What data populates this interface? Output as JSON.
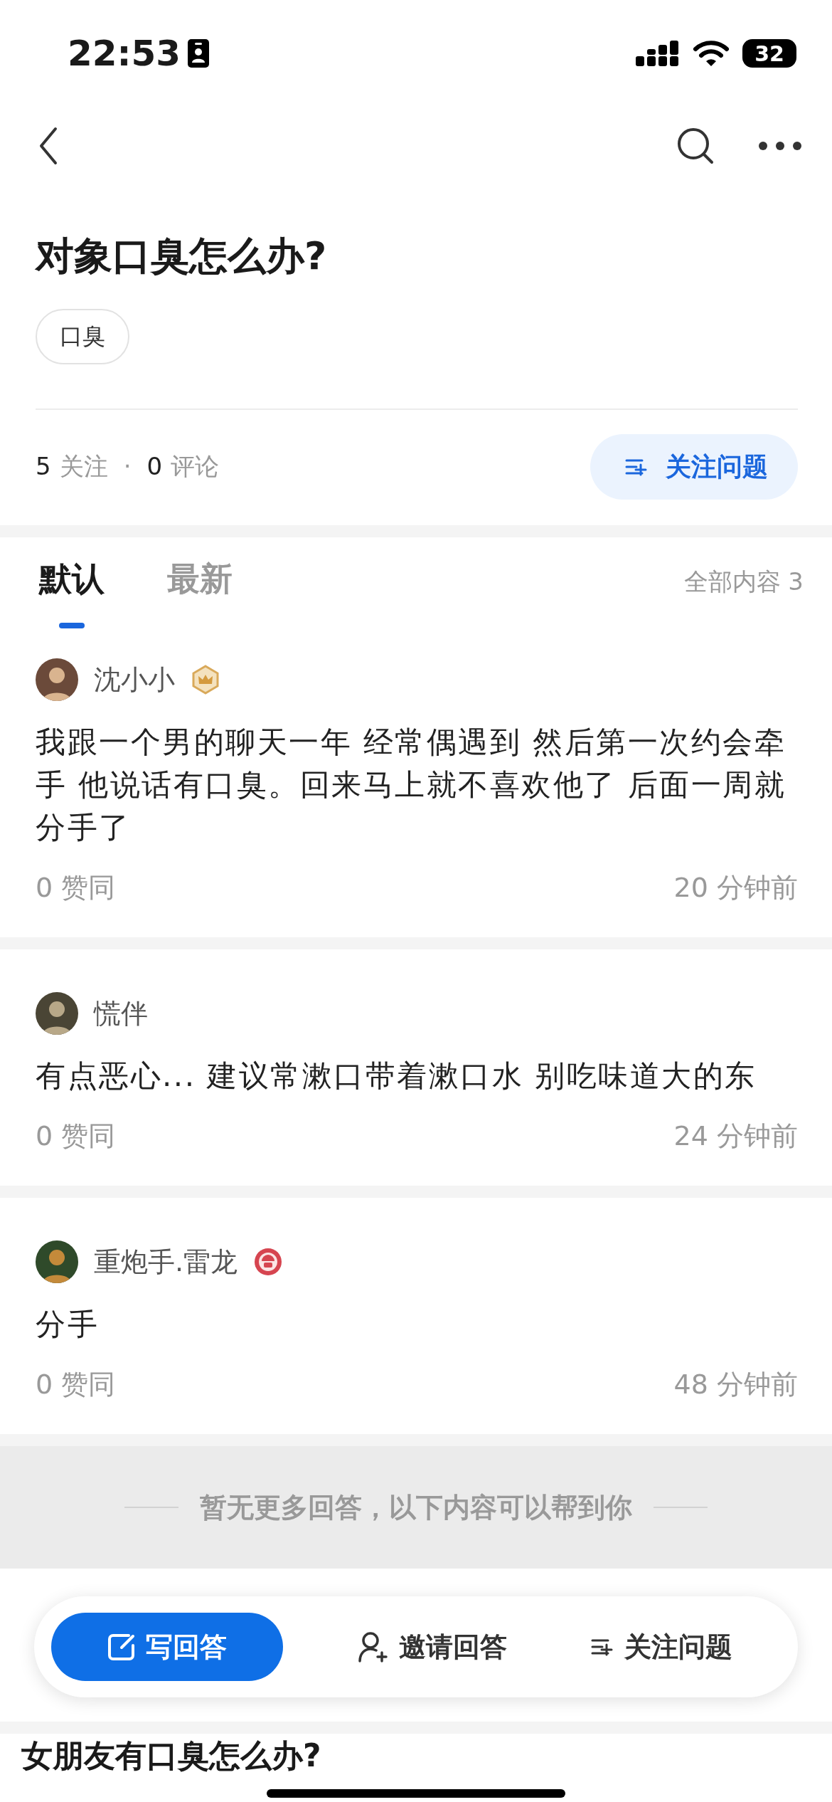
{
  "status_bar": {
    "time": "22:53",
    "battery": "32"
  },
  "question": {
    "title": "对象口臭怎么办?",
    "topics": [
      "口臭"
    ],
    "follow_count": "5",
    "follow_label": "关注",
    "separator": "·",
    "comment_count": "0",
    "comment_label": "评论",
    "follow_button": "关注问题"
  },
  "tabs": [
    {
      "label": "默认",
      "selected": true
    },
    {
      "label": "最新",
      "selected": false
    }
  ],
  "total": "全部内容 3",
  "answers": [
    {
      "author": "沈小小",
      "badge": {
        "kind": "crown"
      },
      "text": "我跟一个男的聊天一年 经常偶遇到 然后第一次约会牵手 他说话有口臭。回来马上就不喜欢他了 后面一周就分手了",
      "votes": "0 赞同",
      "time": "20 分钟前"
    },
    {
      "author": "慌伴",
      "text": "有点恶心... 建议常漱口带着漱口水 别吃味道大的东",
      "votes": "0 赞同",
      "time": "24 分钟前"
    },
    {
      "author": "重炮手.雷龙",
      "badge": {
        "kind": "helmet"
      },
      "text": "分手",
      "votes": "0 赞同",
      "time": "48 分钟前"
    }
  ],
  "end_notice": "暂无更多回答，以下内容可以帮到你",
  "related": [
    {
      "title": "女朋友有口臭怎么办?"
    }
  ],
  "action_bar": [
    {
      "kind": "write",
      "label": "写回答"
    },
    {
      "kind": "invite",
      "label": "邀请回答"
    },
    {
      "kind": "follow",
      "label": "关注问题"
    }
  ]
}
